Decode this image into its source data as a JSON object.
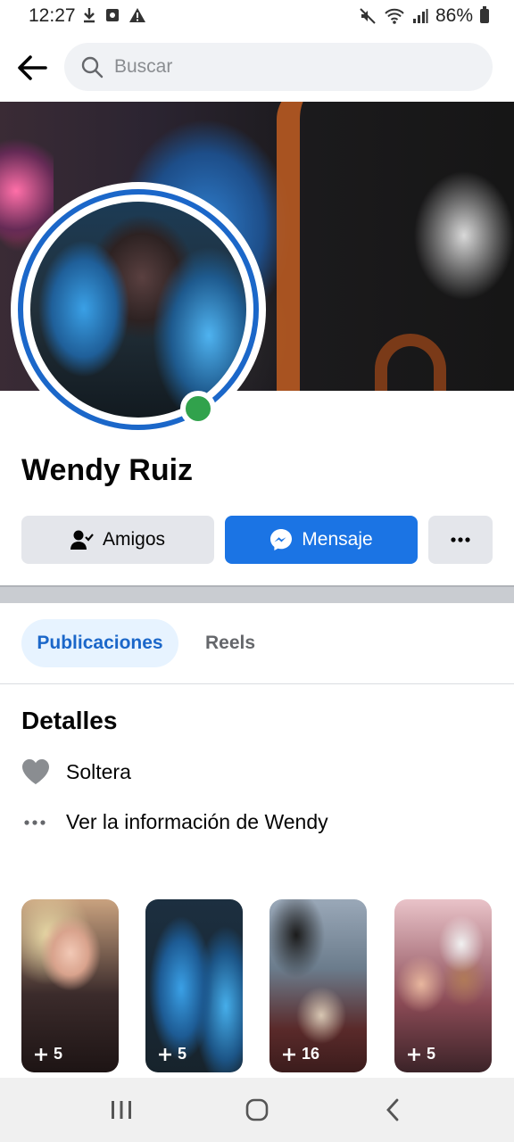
{
  "status_bar": {
    "time": "12:27",
    "battery": "86%",
    "left_icons": [
      "download-icon",
      "screenshot-icon",
      "warning-icon"
    ],
    "right_icons": [
      "mute-icon",
      "wifi-icon",
      "signal-icon",
      "battery-icon"
    ]
  },
  "search": {
    "placeholder": "Buscar"
  },
  "profile": {
    "name": "Wendy Ruiz",
    "online": true
  },
  "actions": {
    "friends_label": "Amigos",
    "message_label": "Mensaje",
    "more_label": "•••"
  },
  "tabs": [
    {
      "label": "Publicaciones",
      "active": true
    },
    {
      "label": "Reels",
      "active": false
    }
  ],
  "details": {
    "title": "Detalles",
    "relationship": "Soltera",
    "see_info": "Ver la información de Wendy"
  },
  "stories": [
    {
      "count": "5"
    },
    {
      "count": "5"
    },
    {
      "count": "16"
    },
    {
      "count": "5"
    }
  ],
  "colors": {
    "accent": "#1b74e4",
    "online": "#31a24c",
    "tab_active_bg": "#e7f3ff"
  }
}
